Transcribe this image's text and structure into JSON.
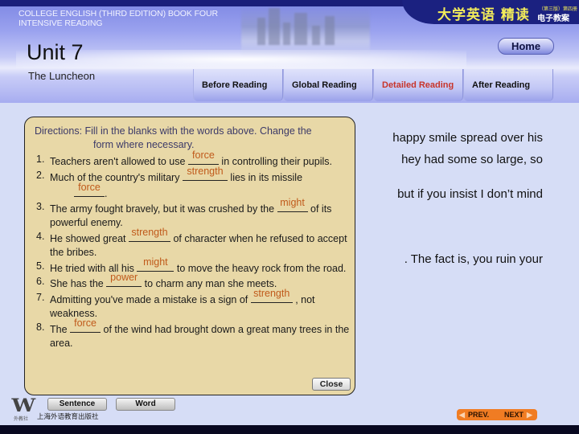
{
  "header": {
    "book_title_line1": "COLLEGE ENGLISH (THIRD EDITION) BOOK FOUR",
    "book_title_line2": "INTENSIVE READING",
    "unit": "Unit 7",
    "unit_subtitle": "The Luncheon",
    "cn_title": "大学英语 精读",
    "cn_edition": "（第三版）第四册",
    "cn_subtitle": "电子教案",
    "home_label": "Home"
  },
  "tabs": [
    {
      "label": "Before Reading",
      "active": false
    },
    {
      "label": "Global Reading",
      "active": false
    },
    {
      "label": "Detailed Reading",
      "active": true
    },
    {
      "label": "After Reading",
      "active": false
    }
  ],
  "background_passage": {
    "line1": "happy smile spread over his",
    "line2": "hey had some so large, so",
    "line3": "but if you insist I don’t mind",
    "line4": ". The fact is, you ruin your"
  },
  "exercise": {
    "directions_line1": "Directions: Fill in the blanks with the words above. Change the",
    "directions_line2": "form where necessary.",
    "items": [
      {
        "num": "1.",
        "before": "Teachers aren't allowed to use ",
        "answer": "force",
        "after": " in controlling their pupils."
      },
      {
        "num": "2.",
        "before": "Much of the country's military ",
        "answer": "strength",
        "after": " lies in its missile ",
        "answer2": "force",
        "after2": "."
      },
      {
        "num": "3.",
        "before": "The army fought bravely, but it was crushed by the ",
        "answer": "might",
        "after": " of its powerful enemy."
      },
      {
        "num": "4.",
        "before": "He showed great ",
        "answer": "strength",
        "after": " of character when he refused to accept the bribes."
      },
      {
        "num": "5.",
        "before": "He tried with all his ",
        "answer": "might",
        "after": "  to move the heavy rock from the road."
      },
      {
        "num": "6.",
        "before": "She has the ",
        "answer": "power",
        "after": " to charm any man she meets."
      },
      {
        "num": "7.",
        "before": "Admitting you've made a mistake is a sign of ",
        "answer": "strength",
        "after": " , not weakness."
      },
      {
        "num": "8.",
        "before": "The ",
        "answer": "force",
        "after": " of the wind had brought down a great many trees in the area."
      }
    ],
    "close_label": "Close"
  },
  "footer": {
    "logo_letter": "W",
    "logo_caption": "外教社",
    "publisher": "上海外语教育出版社",
    "sentence_label": "Sentence",
    "word_label": "Word",
    "prev_label": "PREV.",
    "next_label": "NEXT"
  },
  "colors": {
    "active_tab": "#c8352b",
    "answer": "#c05a1b",
    "panel_bg": "#e8d8a7",
    "nav_accent": "#f07c23"
  }
}
